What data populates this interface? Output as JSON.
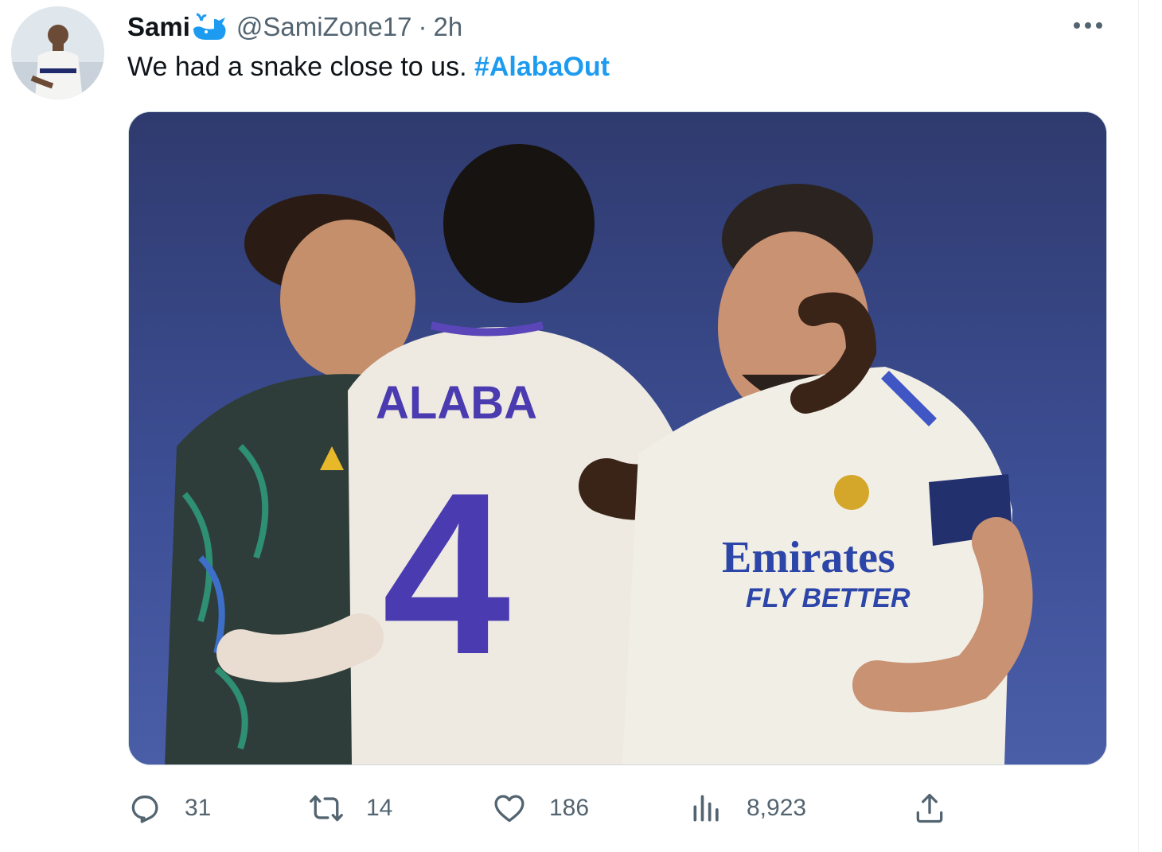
{
  "tweet": {
    "author": {
      "display_name": "Sami",
      "handle": "@SamiZone17",
      "verified_badge_icon": "whale-badge-icon",
      "badge_color": "#1d9bf0"
    },
    "separator": "·",
    "time": "2h",
    "text_plain": "We had a snake close to us.",
    "hashtag": "#AlabaOut",
    "hashtag_color": "#1d9bf0",
    "more_icon": "more-options-icon",
    "media_image_text": {
      "player_name": "ALABA",
      "player_number": "4",
      "sponsor_line1": "Emirates",
      "sponsor_line2": "FLY BETTER"
    },
    "actions": {
      "replies": {
        "icon": "reply-icon",
        "count": "31"
      },
      "retweets": {
        "icon": "retweet-icon",
        "count": "14"
      },
      "likes": {
        "icon": "heart-icon",
        "count": "186"
      },
      "views": {
        "icon": "views-chart-icon",
        "count": "8,923"
      },
      "share": {
        "icon": "share-icon"
      }
    }
  }
}
